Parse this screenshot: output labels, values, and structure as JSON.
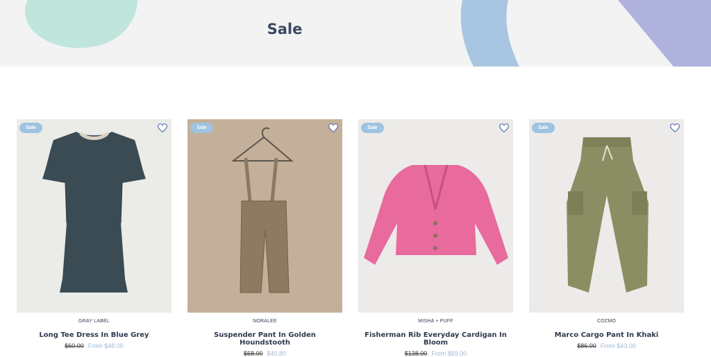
{
  "page": {
    "title": "Sale"
  },
  "colors": {
    "accent": "#9fc3e0",
    "hero_bg": "#f3f3f4",
    "title": "#3c4863",
    "sale_price": "#9dbbd9"
  },
  "products": [
    {
      "badge": "Sale",
      "brand": "GRAY LABEL",
      "name": "Long Tee Dress In Blue Grey",
      "old_price": "$60.00",
      "new_price": "From $48.00",
      "wishlist_icon": "heart-icon"
    },
    {
      "badge": "Sale",
      "brand": "NORALEE",
      "name": "Suspender Pant In Golden Houndstooth",
      "old_price": "$68.00",
      "new_price": "$40.80",
      "wishlist_icon": "heart-icon"
    },
    {
      "badge": "Sale",
      "brand": "MISHA + PUFF",
      "name": "Fisherman Rib Everyday Cardigan In Bloom",
      "old_price": "$138.00",
      "new_price": "From $69.00",
      "wishlist_icon": "heart-icon"
    },
    {
      "badge": "Sale",
      "brand": "COZMO",
      "name": "Marco Cargo Pant In Khaki",
      "old_price": "$86.00",
      "new_price": "From $43.00",
      "wishlist_icon": "heart-icon"
    }
  ]
}
